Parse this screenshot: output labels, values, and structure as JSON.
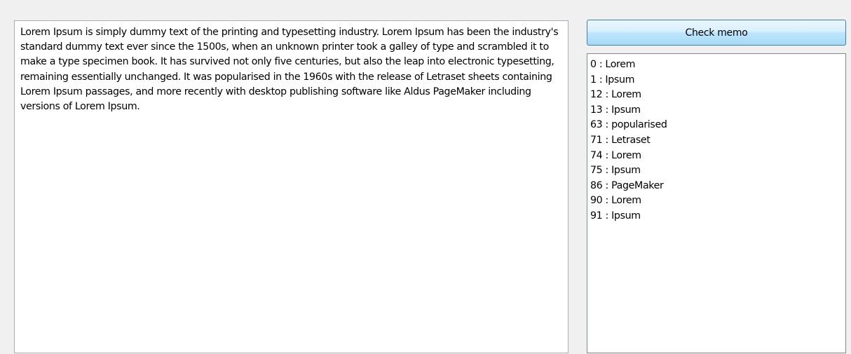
{
  "memo": {
    "text": "Lorem Ipsum is simply dummy text of the printing and typesetting industry. Lorem Ipsum has been the industry's standard dummy text ever since the 1500s, when an unknown printer took a galley of type and scrambled it to make a type specimen book. It has survived not only five centuries, but also the leap into electronic typesetting, remaining essentially unchanged. It was popularised in the 1960s with the release of Letraset sheets containing Lorem Ipsum passages, and more recently with desktop publishing software like Aldus PageMaker including versions of Lorem Ipsum."
  },
  "button": {
    "label": "Check memo"
  },
  "list": {
    "items": [
      "0 : Lorem",
      "1 : Ipsum",
      "12 : Lorem",
      "13 : Ipsum",
      "63 : popularised",
      "71 : Letraset",
      "74 : Lorem",
      "75 : Ipsum",
      "86 : PageMaker",
      "90 : Lorem",
      "91 : Ipsum"
    ]
  }
}
